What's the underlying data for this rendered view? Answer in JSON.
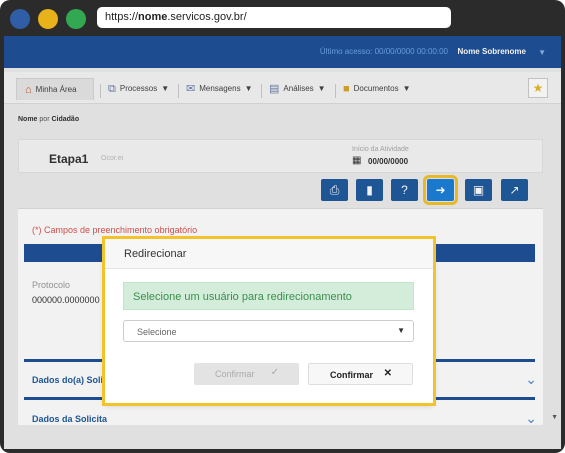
{
  "browser": {
    "url_prefix": "https://",
    "url_domain": "nome",
    "url_suffix": ".servicos.gov.br/"
  },
  "header": {
    "last_access": "Último acesso: 00/00/0000 00:00:00",
    "user_name": "Nome Sobrenome"
  },
  "nav": {
    "items": [
      {
        "label": "Minha Área",
        "icon": "home-icon"
      },
      {
        "label": "Processos",
        "icon": "sitemap-icon"
      },
      {
        "label": "Mensagens",
        "icon": "envelope-icon"
      },
      {
        "label": "Análises",
        "icon": "analysis-icon"
      },
      {
        "label": "Documentos",
        "icon": "folder-icon"
      }
    ]
  },
  "breadcrumb": {
    "name": "Nome",
    "connector": "por",
    "role": "Cidadão"
  },
  "step": {
    "title": "Etapa1",
    "subtitle": "Ocor.ei",
    "activity_label": "Início da Atividade",
    "activity_date": "00/00/0000"
  },
  "toolbar": {
    "buttons": [
      "print-icon",
      "bookmark-icon",
      "help-icon",
      "redirect-icon",
      "save-icon",
      "chart-icon"
    ]
  },
  "form": {
    "required_note": "(*) Campos de preenchimento obrigatório",
    "protocol_label": "Protocolo",
    "protocol_value": "000000.0000000",
    "section1": "Dados do(a) Solici",
    "section2": "Dados da Solicita"
  },
  "modal": {
    "title": "Redirecionar",
    "alert": "Selecione um usuário para redirecionamento",
    "select_placeholder": "Selecione",
    "confirm_disabled_label": "Confirmar",
    "confirm_label": "Confirmar"
  },
  "colors": {
    "primary": "#1f5199",
    "highlight": "#f2c32b",
    "alert_bg": "#d4edda",
    "alert_text": "#3b8e4f",
    "required": "#d9534f"
  }
}
